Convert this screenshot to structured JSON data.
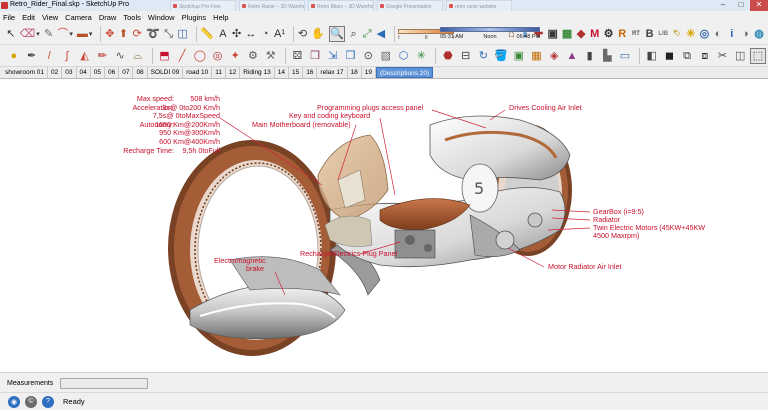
{
  "window": {
    "title": "Retro_Rider_Final.skp - SketchUp Pro",
    "ghost_tabs": [
      "Sketchup Pro Free",
      "Retro Racer – 3D Warehouse",
      "Retro Bikes – 3D Warehouse",
      "Google Presentation",
      "retro racer website"
    ],
    "controls": {
      "minimize": "–",
      "maximize": "□",
      "close": "✕"
    }
  },
  "menu": [
    "File",
    "Edit",
    "View",
    "Camera",
    "Draw",
    "Tools",
    "Window",
    "Plugins",
    "Help"
  ],
  "toolbar1": {
    "tools": [
      {
        "name": "select-icon",
        "glyph": "↖"
      },
      {
        "name": "eraser-icon",
        "glyph": "⌫"
      },
      {
        "name": "pencil-icon",
        "glyph": "✎"
      },
      {
        "name": "arc-icon",
        "glyph": "⌒"
      },
      {
        "name": "rectangle-icon",
        "glyph": "▬"
      },
      {
        "name": "move-icon",
        "glyph": "✥"
      },
      {
        "name": "pushpull-icon",
        "glyph": "⬆"
      },
      {
        "name": "rotate-icon",
        "glyph": "⟳"
      },
      {
        "name": "followme-icon",
        "glyph": "➰"
      },
      {
        "name": "scale-icon",
        "glyph": "⤡"
      },
      {
        "name": "offset-icon",
        "glyph": "◫"
      },
      {
        "name": "tape-icon",
        "glyph": "📏"
      },
      {
        "name": "text-icon",
        "glyph": "A"
      },
      {
        "name": "axes-icon",
        "glyph": "✣"
      },
      {
        "name": "dimension-icon",
        "glyph": "↔"
      },
      {
        "name": "protractor-icon",
        "glyph": "◔"
      },
      {
        "name": "label-icon",
        "glyph": "A¹"
      },
      {
        "name": "orbit-icon",
        "glyph": "⟲"
      },
      {
        "name": "pan-icon",
        "glyph": "✋"
      },
      {
        "name": "zoom-icon",
        "glyph": "🔍"
      },
      {
        "name": "zoom-window-icon",
        "glyph": "⌕"
      },
      {
        "name": "zoom-extents-icon",
        "glyph": "⤢"
      },
      {
        "name": "previous-view-icon",
        "glyph": "◀"
      }
    ],
    "shadow_widget": {
      "start": "I",
      "mid": "II",
      "end": "I"
    },
    "time_widget": {
      "sunrise": "05:31 AM",
      "noon": "Noon",
      "sunset": "06:48 PM"
    },
    "right_tools": [
      {
        "name": "warehouse-icon",
        "glyph": "⌂"
      },
      {
        "name": "share-model-icon",
        "glyph": "⇪"
      },
      {
        "name": "extension-warehouse-icon",
        "glyph": "✚"
      },
      {
        "name": "layout-icon",
        "glyph": "▣"
      },
      {
        "name": "match-photo-icon",
        "glyph": "▦"
      },
      {
        "name": "ruby-console-icon",
        "glyph": "◆"
      },
      {
        "name": "render-m-icon",
        "glyph": "M"
      },
      {
        "name": "render-settings-icon",
        "glyph": "⚙"
      },
      {
        "name": "render-r-icon",
        "glyph": "R"
      },
      {
        "name": "render-rt-icon",
        "glyph": "RT"
      },
      {
        "name": "render-b-icon",
        "glyph": "B"
      },
      {
        "name": "render-lib-icon",
        "glyph": "LIB"
      },
      {
        "name": "tag-icon",
        "glyph": "🏷"
      },
      {
        "name": "light-icon",
        "glyph": "☀"
      },
      {
        "name": "ies-icon",
        "glyph": "◎"
      },
      {
        "name": "material-icon",
        "glyph": "◐"
      },
      {
        "name": "info-icon",
        "glyph": "i"
      },
      {
        "name": "material-edit-icon",
        "glyph": "◑"
      },
      {
        "name": "globe-icon",
        "glyph": "◍"
      }
    ]
  },
  "toolbar2": {
    "tools": [
      {
        "name": "sphere-icon",
        "glyph": "●"
      },
      {
        "name": "pen-icon",
        "glyph": "✒"
      },
      {
        "name": "line-icon",
        "glyph": "/"
      },
      {
        "name": "curve-icon",
        "glyph": "∫"
      },
      {
        "name": "shape-icon",
        "glyph": "◭"
      },
      {
        "name": "edit-icon",
        "glyph": "✏"
      },
      {
        "name": "bezier-icon",
        "glyph": "∿"
      },
      {
        "name": "round-corner-icon",
        "glyph": "⌓"
      },
      {
        "name": "extrude-icon",
        "glyph": "⬒"
      },
      {
        "name": "line-draw-icon",
        "glyph": "╱"
      },
      {
        "name": "circle-icon",
        "glyph": "◯"
      },
      {
        "name": "target-icon",
        "glyph": "◎"
      },
      {
        "name": "stamp-icon",
        "glyph": "✦"
      },
      {
        "name": "spring-icon",
        "glyph": "⚙"
      },
      {
        "name": "weld-icon",
        "glyph": "⚒"
      },
      {
        "name": "subdivide-icon",
        "glyph": "⚄"
      },
      {
        "name": "cube-icon",
        "glyph": "❒"
      },
      {
        "name": "fredo-scale-icon",
        "glyph": "⇲"
      },
      {
        "name": "duplicate-icon",
        "glyph": "❐"
      },
      {
        "name": "tube-icon",
        "glyph": "⊙"
      },
      {
        "name": "profile-icon",
        "glyph": "▧"
      },
      {
        "name": "component-icon",
        "glyph": "⬡"
      },
      {
        "name": "lattice-icon",
        "glyph": "✳"
      },
      {
        "name": "joint-icon",
        "glyph": "⬣"
      },
      {
        "name": "section-icon",
        "glyph": "⊟"
      },
      {
        "name": "rotate3d-icon",
        "glyph": "↻"
      },
      {
        "name": "paint-icon",
        "glyph": "🪣"
      },
      {
        "name": "box-icon",
        "glyph": "▣"
      },
      {
        "name": "grid-icon",
        "glyph": "▦"
      },
      {
        "name": "color-cube-icon",
        "glyph": "◈"
      },
      {
        "name": "pyramid-icon",
        "glyph": "▲"
      },
      {
        "name": "block-icon",
        "glyph": "▮"
      },
      {
        "name": "stairs-icon",
        "glyph": "▙"
      },
      {
        "name": "plank-icon",
        "glyph": "▭"
      },
      {
        "name": "face-icon",
        "glyph": "◧"
      },
      {
        "name": "solid-icon",
        "glyph": "◼"
      },
      {
        "name": "intersect-icon",
        "glyph": "⧉"
      },
      {
        "name": "union-icon",
        "glyph": "⧈"
      },
      {
        "name": "trim-icon",
        "glyph": "✂"
      },
      {
        "name": "split-icon",
        "glyph": "◫"
      },
      {
        "name": "outer-shell-icon",
        "glyph": "⬚"
      }
    ]
  },
  "scenes": [
    "showroom 01",
    "02",
    "03",
    "04",
    "05",
    "06",
    "07",
    "08",
    "SOLDI 09",
    "road 10",
    "11",
    "12",
    "Riding 13",
    "14",
    "15",
    "16",
    "relax 17",
    "18",
    "19",
    "(Descriptions 20)"
  ],
  "active_scene_index": 19,
  "specs": [
    {
      "label": "Max speed:",
      "value": "508 km/h"
    },
    {
      "label": "Acceleration:",
      "value": "3s@ 0to200 Km/h"
    },
    {
      "label": "",
      "value": "7,5s@ 0toMaxSpeed"
    },
    {
      "label": "Autonomy:",
      "value": "1650 Km@200Km/h"
    },
    {
      "label": "",
      "value": "950 Km@300Km/h"
    },
    {
      "label": "",
      "value": "600 Km@400Km/h"
    },
    {
      "label": "Recharge Time:",
      "value": "9,5h 0toFull"
    }
  ],
  "annotations": {
    "programming_plugs": "Programming plugs access panel",
    "keyboard": "Key and coding keyboard",
    "motherboard": "Main Motherboard (removable)",
    "drives_cooling": "Drives Cooling Air Inlet",
    "gearbox": "GearBox (i=9:5)",
    "radiator": "Radiator",
    "motors": "Twin Electric Motors (45KW+45KW",
    "motors_rpm": "4500 Maxrpm)",
    "motor_radiator": "Motor Radiator Air Inlet",
    "brake_1": "Electromagnetic",
    "brake_2": "brake",
    "plug": "Recharge/Electrics Plug Panel"
  },
  "measurements_label": "Measurements",
  "status": "Ready",
  "colors": {
    "annotation": "#c8102e",
    "active_tab": "#5c93d8",
    "leader": "#d0243c"
  }
}
